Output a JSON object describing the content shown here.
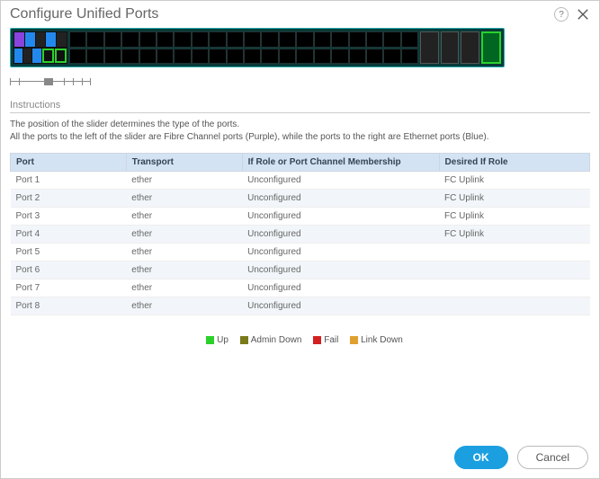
{
  "header": {
    "title": "Configure Unified Ports"
  },
  "instructions": {
    "label": "Instructions",
    "line1": "The position of the slider determines the type of the ports.",
    "line2": "All the ports to the left of the slider are Fibre Channel ports (Purple), while the ports to the right are Ethernet ports (Blue)."
  },
  "table": {
    "headers": {
      "port": "Port",
      "transport": "Transport",
      "role": "If Role or Port Channel Membership",
      "desired": "Desired If Role"
    },
    "rows": [
      {
        "port": "Port 1",
        "transport": "ether",
        "role": "Unconfigured",
        "desired": "FC Uplink"
      },
      {
        "port": "Port 2",
        "transport": "ether",
        "role": "Unconfigured",
        "desired": "FC Uplink"
      },
      {
        "port": "Port 3",
        "transport": "ether",
        "role": "Unconfigured",
        "desired": "FC Uplink"
      },
      {
        "port": "Port 4",
        "transport": "ether",
        "role": "Unconfigured",
        "desired": "FC Uplink"
      },
      {
        "port": "Port 5",
        "transport": "ether",
        "role": "Unconfigured",
        "desired": ""
      },
      {
        "port": "Port 6",
        "transport": "ether",
        "role": "Unconfigured",
        "desired": ""
      },
      {
        "port": "Port 7",
        "transport": "ether",
        "role": "Unconfigured",
        "desired": ""
      },
      {
        "port": "Port 8",
        "transport": "ether",
        "role": "Unconfigured",
        "desired": ""
      }
    ]
  },
  "legend": {
    "up": "Up",
    "admin_down": "Admin Down",
    "fail": "Fail",
    "link_down": "Link Down"
  },
  "buttons": {
    "ok": "OK",
    "cancel": "Cancel"
  }
}
